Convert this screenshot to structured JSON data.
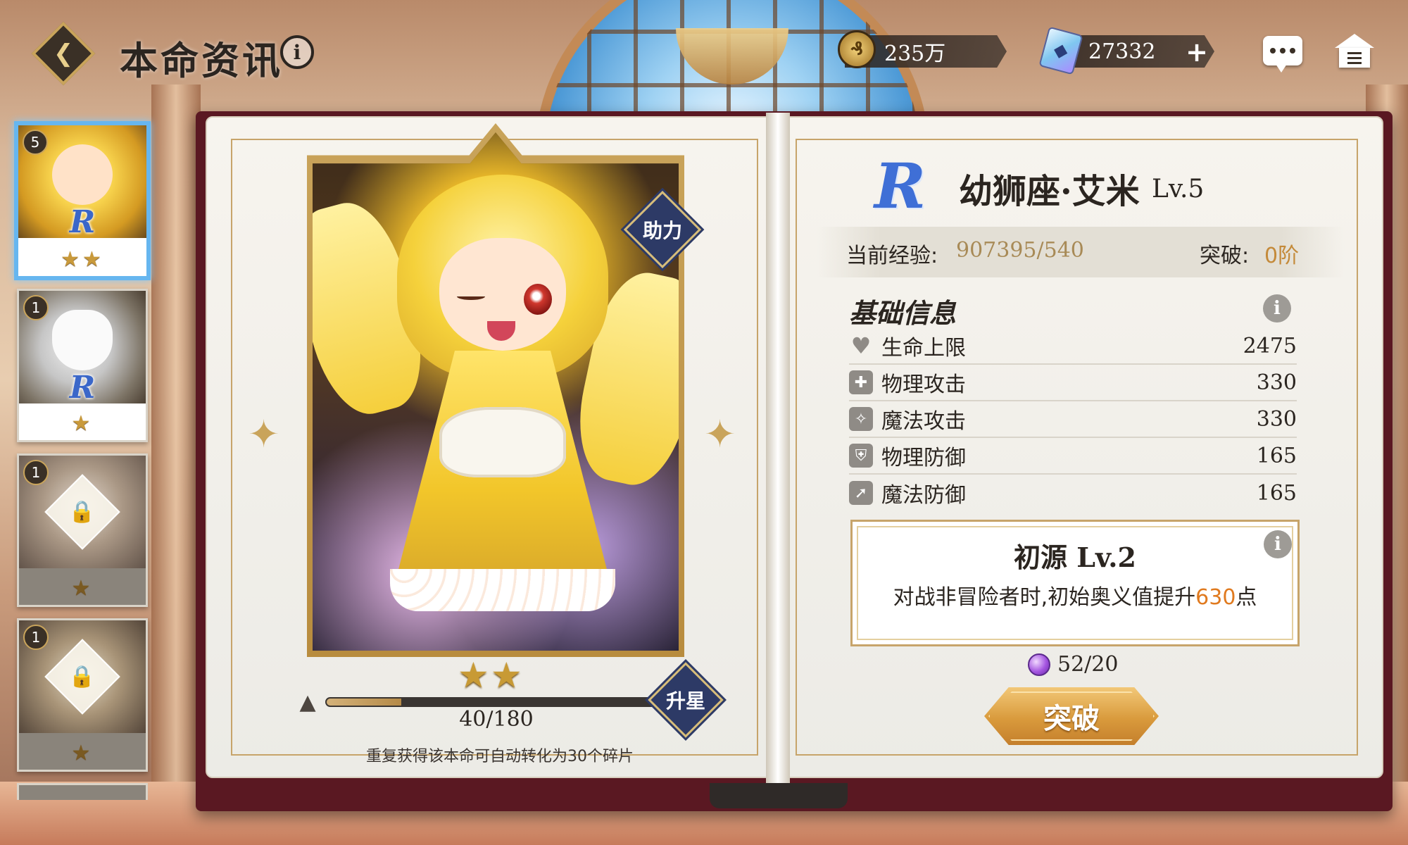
{
  "colors": {
    "accent_blue": "#3f6fd6",
    "gold": "#c9a45b",
    "exp_value": "#a88a56",
    "highlight_orange": "#e07a1f",
    "book_cover": "#5a1822",
    "badge_navy": "#2d3a66"
  },
  "header": {
    "title": "本命资讯",
    "info_icon": "i",
    "back_icon": "back-diamond-icon",
    "gold": {
      "icon": "coin-icon",
      "amount": "235万"
    },
    "gems": {
      "icon": "crystal-icon",
      "amount": "27332",
      "add_label": "+"
    },
    "chat_icon": "chat-bubble-icon",
    "home_icon": "home-icon"
  },
  "sidebar": {
    "cards": [
      {
        "count": "5",
        "rarity": "R",
        "stars": "★★",
        "stars_count": 2,
        "selected": true,
        "locked": false
      },
      {
        "count": "1",
        "rarity": "R",
        "stars": "★",
        "stars_count": 1,
        "selected": false,
        "locked": false
      },
      {
        "count": "1",
        "rarity": "",
        "stars": "★",
        "stars_count": 1,
        "selected": false,
        "locked": true
      },
      {
        "count": "1",
        "rarity": "",
        "stars": "★",
        "stars_count": 1,
        "selected": false,
        "locked": true
      }
    ]
  },
  "left_page": {
    "assist_label": "助力",
    "stars": "★★",
    "stars_count": 2,
    "progress": {
      "current": 40,
      "max": 180,
      "text": "40/180"
    },
    "upgrade_label": "升星",
    "shard_note": "重复获得该本命可自动转化为30个碎片"
  },
  "right_page": {
    "rarity": "R",
    "name": "幼狮座·艾米",
    "level": "Lv.5",
    "exp_label": "当前经验:",
    "exp_value": "907395/540",
    "break_label": "突破:",
    "break_value": "0阶",
    "section_title": "基础信息",
    "stats": [
      {
        "icon": "heart-icon",
        "label": "生命上限",
        "value": "2475"
      },
      {
        "icon": "sword-icon",
        "label": "物理攻击",
        "value": "330"
      },
      {
        "icon": "staff-icon",
        "label": "魔法攻击",
        "value": "330"
      },
      {
        "icon": "shield-icon",
        "label": "物理防御",
        "value": "165"
      },
      {
        "icon": "magic-shield-icon",
        "label": "魔法防御",
        "value": "165"
      }
    ],
    "skill": {
      "title": "初源 Lv.2",
      "desc_prefix": "对战非冒险者时,初始奥义值提升",
      "desc_value": "630",
      "desc_suffix": "点"
    },
    "material": {
      "icon": "purple-gem-icon",
      "text": "52/20"
    },
    "breakthrough_label": "突破"
  }
}
